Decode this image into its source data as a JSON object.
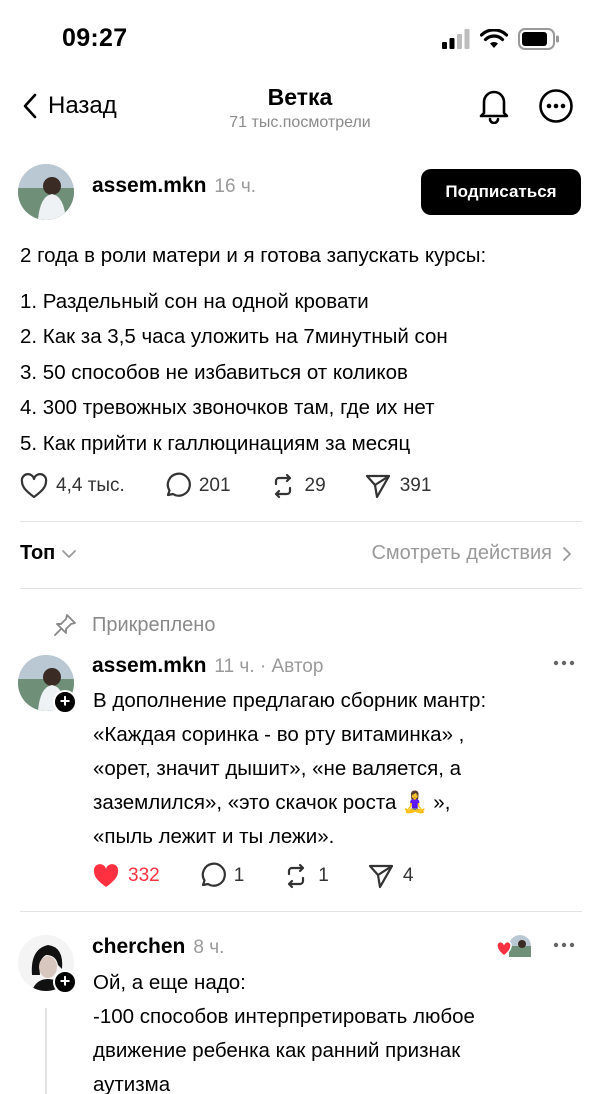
{
  "status": {
    "time": "09:27"
  },
  "nav": {
    "back_label": "Назад",
    "title": "Ветка",
    "subtitle": "71 тыс.посмотрели"
  },
  "post": {
    "username": "assem.mkn",
    "time": "16 ч.",
    "follow_label": "Подписаться",
    "intro": "2 года в роли матери и я готова запускать курсы:",
    "items": [
      "1. Раздельный сон на одной кровати",
      "2. Как за 3,5 часа уложить на 7минутный сон",
      "3. 50 способов не избавиться от коликов",
      "4. 300 тревожных звоночков там, где их нет",
      "5. Как прийти к галлюцинациям за месяц"
    ],
    "likes": "4,4 тыс.",
    "replies": "201",
    "reposts": "29",
    "shares": "391"
  },
  "sort": {
    "label": "Топ",
    "activity_label": "Смотреть действия"
  },
  "pinned_label": "Прикреплено",
  "reply1": {
    "username": "assem.mkn",
    "time": "11 ч. · Автор",
    "lines": [
      "В дополнение предлагаю сборник мантр:",
      "«Каждая соринка - во рту витаминка» ,",
      "«орет, значит дышит», «не валяется, а",
      "заземлился», «это скачок роста 🧘‍♀️ »,",
      "«пыль лежит и ты лежи»."
    ],
    "likes": "332",
    "replies": "1",
    "reposts": "1",
    "shares": "4",
    "like_color": "#ff3040"
  },
  "reply2": {
    "username": "cherchen",
    "time": "8 ч.",
    "lines": [
      "Ой, а еще надо:",
      "-100 способов интерпретировать любое",
      "движение ребенка как ранний признак",
      "аутизма"
    ]
  }
}
